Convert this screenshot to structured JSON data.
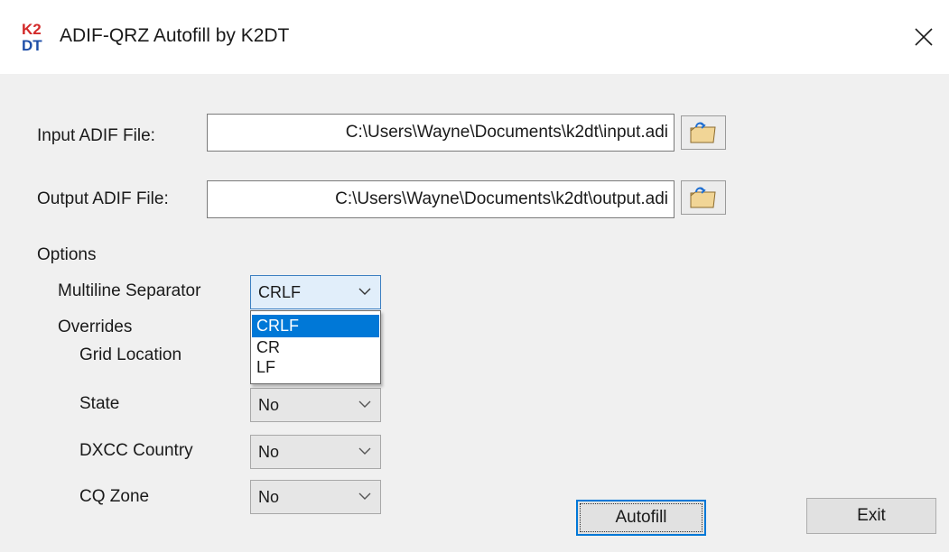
{
  "window": {
    "title": "ADIF-QRZ Autofill by K2DT",
    "icon_name": "k2dt-app-icon",
    "icon_text_top": "K2",
    "icon_text_bottom": "DT",
    "close_symbol": "✕"
  },
  "input_file": {
    "label": "Input ADIF File:",
    "value": "C:\\Users\\Wayne\\Documents\\k2dt\\input.adi",
    "browse_icon": "folder-open-icon"
  },
  "output_file": {
    "label": "Output ADIF File:",
    "value": "C:\\Users\\Wayne\\Documents\\k2dt\\output.adi",
    "browse_icon": "folder-open-icon"
  },
  "options": {
    "heading": "Options",
    "multiline_separator": {
      "label": "Multiline Separator",
      "selected": "CRLF",
      "options": [
        "CRLF",
        "CR",
        "LF"
      ],
      "highlighted": "CRLF"
    },
    "overrides": {
      "heading": "Overrides",
      "grid_location": {
        "label": "Grid Location"
      },
      "state": {
        "label": "State",
        "value": "No"
      },
      "dxcc_country": {
        "label": "DXCC Country",
        "value": "No"
      },
      "cq_zone": {
        "label": "CQ Zone",
        "value": "No"
      }
    }
  },
  "buttons": {
    "autofill": "Autofill",
    "exit": "Exit"
  },
  "colors": {
    "accent": "#0078d7",
    "icon_red": "#d32a2a",
    "icon_blue": "#1f4fa8"
  }
}
